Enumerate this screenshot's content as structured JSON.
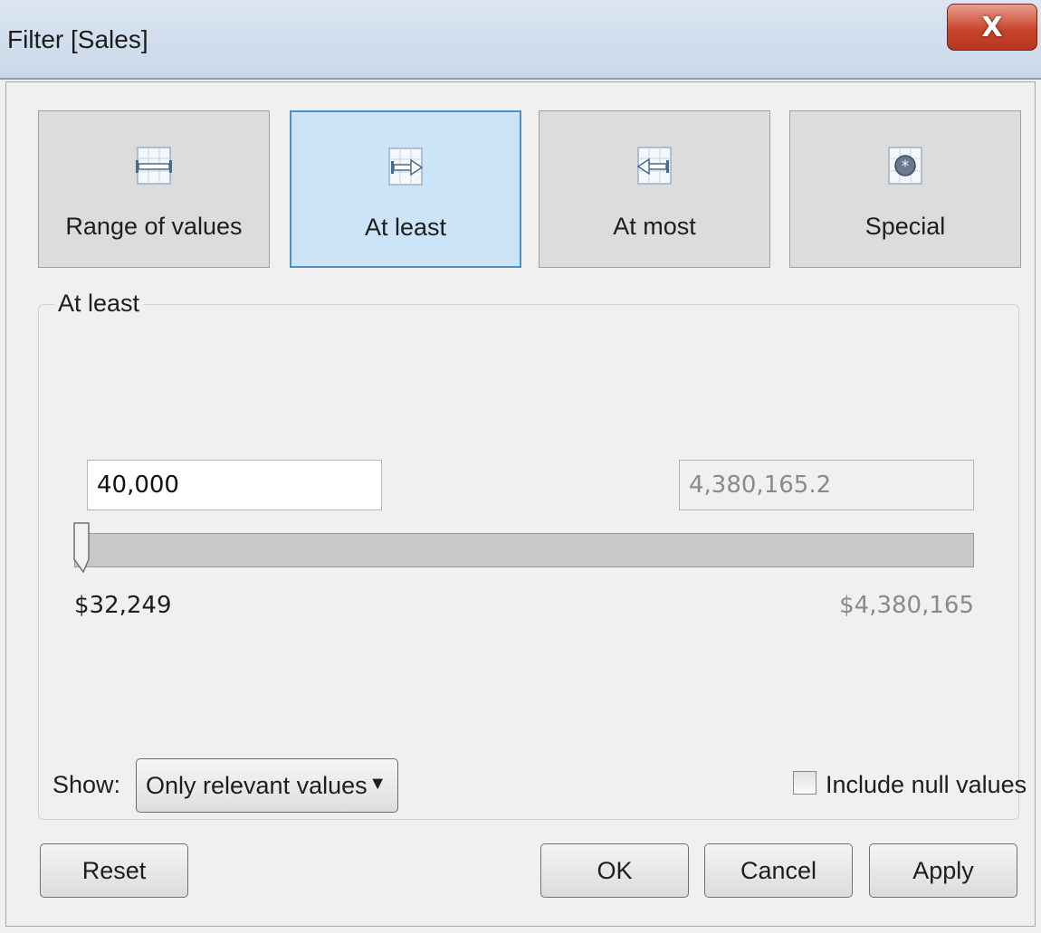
{
  "window": {
    "title": "Filter [Sales]",
    "close_label": "X"
  },
  "modes": {
    "range": "Range of values",
    "at_least": "At least",
    "at_most": "At most",
    "special": "Special",
    "selected": "At least"
  },
  "group": {
    "label": "At least"
  },
  "range": {
    "min_value": "40,000",
    "max_value": "4,380,165.2",
    "min_label": "$32,249",
    "max_label": "$4,380,165",
    "slider_position_fraction": 0
  },
  "show": {
    "label": "Show:",
    "selected": "Only relevant values"
  },
  "null_option": {
    "label": "Include null values",
    "checked": false
  },
  "buttons": {
    "reset": "Reset",
    "ok": "OK",
    "cancel": "Cancel",
    "apply": "Apply"
  },
  "colors": {
    "selected_mode_bg": "#cce4f7",
    "selected_mode_border": "#4a90c8",
    "close_button": "#c8452d"
  }
}
